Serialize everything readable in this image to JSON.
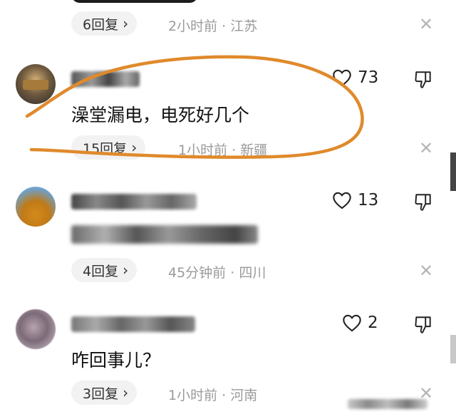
{
  "comments": [
    {
      "replies": "6回复",
      "time": "2小时前",
      "region": "江苏"
    },
    {
      "text": "澡堂漏电，电死好几个",
      "likes": "73",
      "replies": "15回复",
      "time": "1小时前",
      "region": "新疆"
    },
    {
      "likes": "13",
      "replies": "4回复",
      "time": "45分钟前",
      "region": "四川"
    },
    {
      "text": "咋回事儿？",
      "likes": "2",
      "replies": "3回复",
      "time": "1小时前",
      "region": "河南"
    }
  ],
  "sep": " · ",
  "icons": {
    "like": "heart-outline-icon",
    "dislike": "thumbs-down-icon",
    "close": "close-icon",
    "chevron": "chevron-right-icon"
  },
  "colors": {
    "annotation": "#e08a2c",
    "meta_text": "#9a9a9a",
    "pill_bg": "#f2f2f2"
  }
}
